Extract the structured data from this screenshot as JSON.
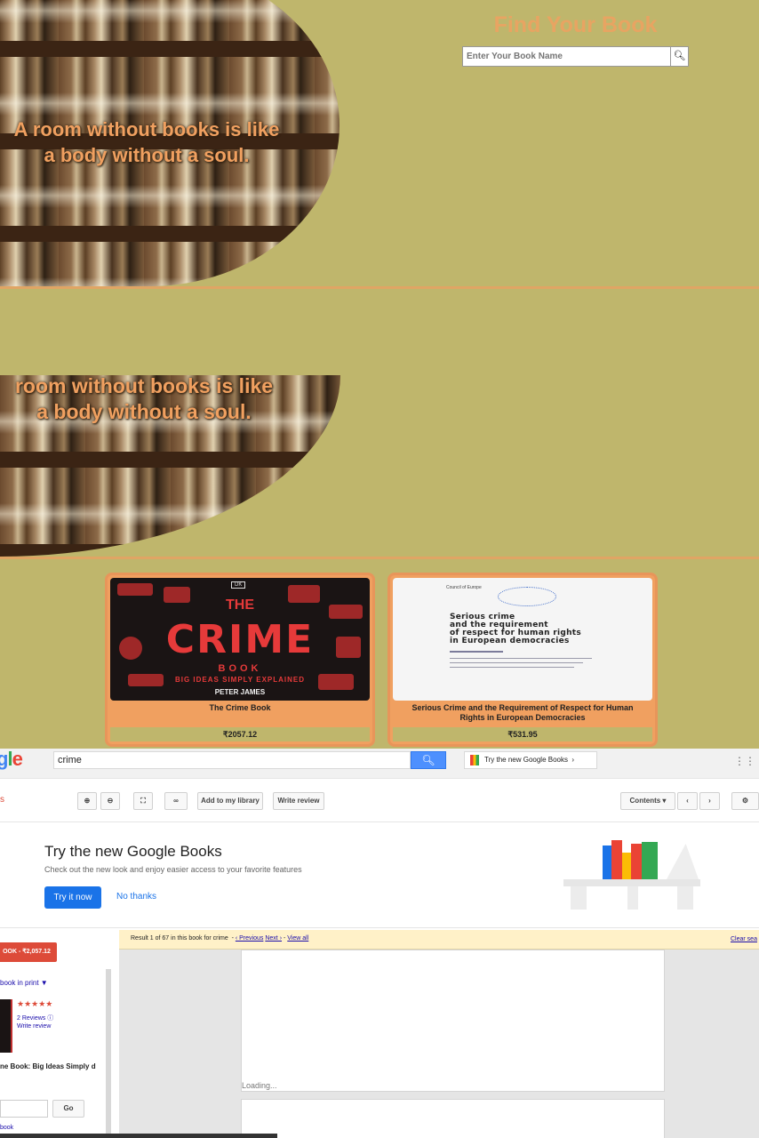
{
  "hero": {
    "quote_line1": "A room without books is like",
    "quote_line2": "a body without a soul."
  },
  "hero2": {
    "quote_line1": "room without books is like",
    "quote_line2": "a body without a soul."
  },
  "finder": {
    "title": "Find Your Book",
    "placeholder": "Enter Your Book Name",
    "search_icon": "search-icon"
  },
  "books": [
    {
      "title": "The Crime Book",
      "price": "₹2057.12",
      "cover": {
        "the": "THE",
        "main": "CRIME",
        "book": "BOOK",
        "sub": "BIG IDEAS SIMPLY EXPLAINED",
        "author": "PETER JAMES",
        "publisher": "DK"
      }
    },
    {
      "title": "Serious Crime and the Requirement of Respect for Human Rights in European Democracies",
      "price": "₹531.95",
      "cover": {
        "org": "Council of Europe",
        "title_lines": [
          "Serious crime",
          "and the requirement",
          "of respect for human rights",
          "in European democracies"
        ]
      }
    }
  ],
  "gbooks": {
    "logo": "gle",
    "query": "crime",
    "try_new": "Try the new Google Books",
    "left_label": "s",
    "toolbar": {
      "add_library": "Add to my library",
      "write_review": "Write review",
      "contents": "Contents"
    },
    "promo": {
      "title": "Try the new Google Books",
      "subtitle": "Check out the new look and enjoy easier access to your favorite features",
      "try_button": "Try it now",
      "no_thanks": "No thanks"
    },
    "buy": "OOK - ₹2,057.12",
    "in_print": "book in print ▼",
    "rating_stars": "★★★★★",
    "reviews": "2 Reviews",
    "write_review": "Write review",
    "book_title": "ne Book: Big Ideas Simply d",
    "go": "Go",
    "small_link": "book",
    "results": {
      "text": "Result 1 of 67 in this book for crime",
      "previous": "‹ Previous",
      "next": "Next ›",
      "view_all": "View all",
      "clear": "Clear sea"
    },
    "loading": "Loading..."
  }
}
